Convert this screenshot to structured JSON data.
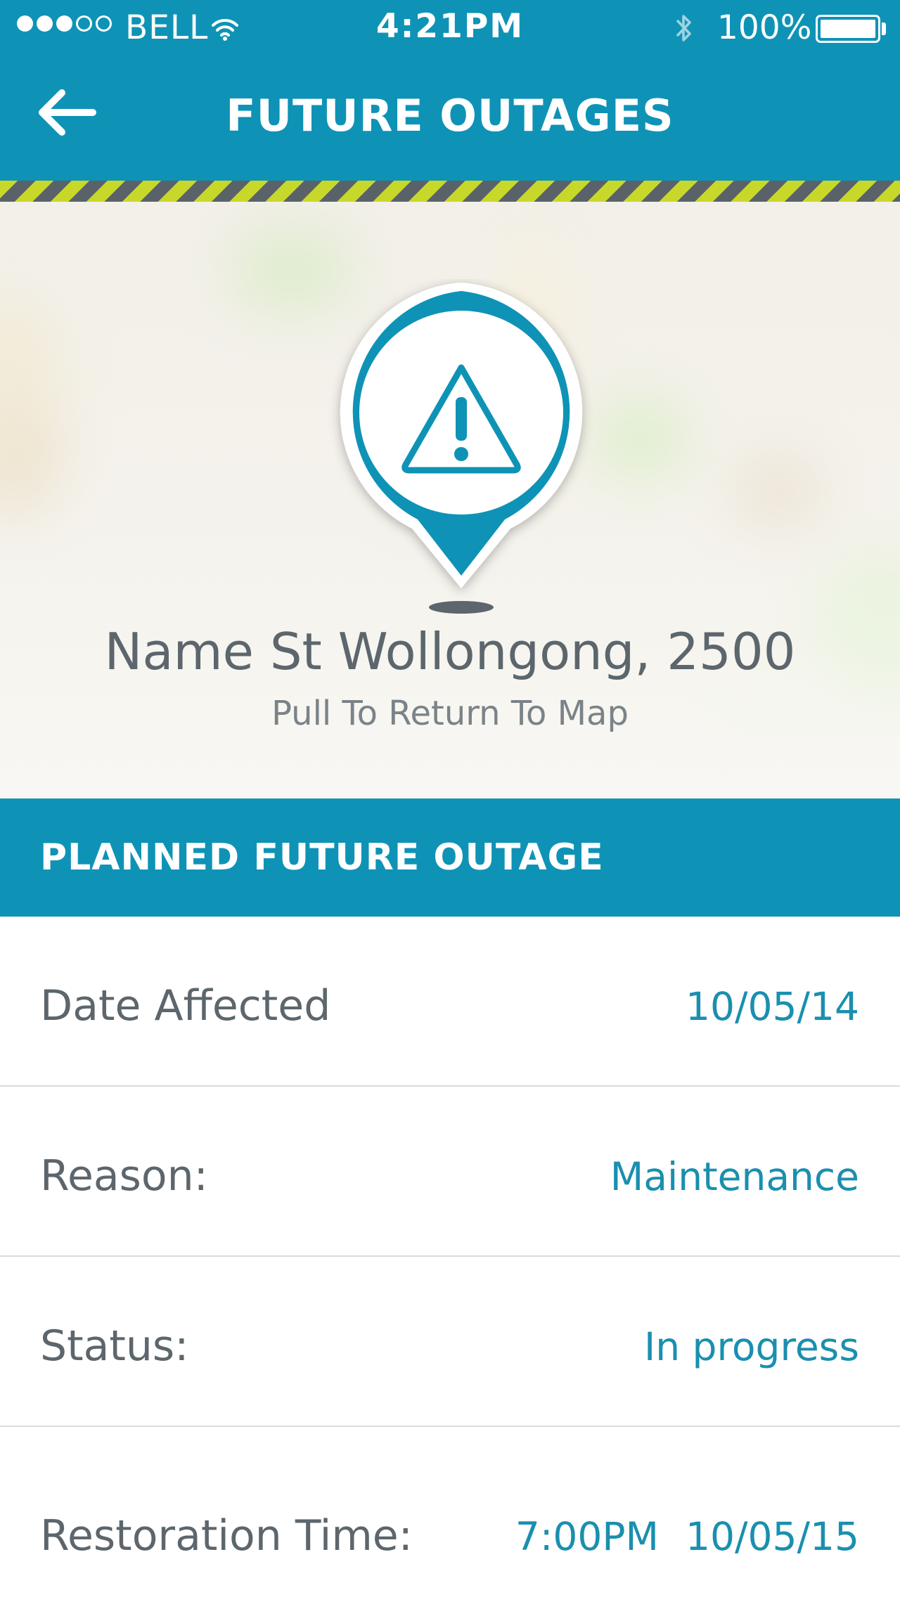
{
  "status_bar": {
    "carrier": "BELL",
    "time": "4:21PM",
    "battery": "100%",
    "battery_level": 1.0
  },
  "header": {
    "title": "FUTURE OUTAGES",
    "back_icon": "arrow-left-icon"
  },
  "hero": {
    "pin_icon": "warning-triangle-icon",
    "location": "Name St Wollongong, 2500",
    "hint": "Pull To Return To Map"
  },
  "section": {
    "title": "PLANNED FUTURE OUTAGE"
  },
  "details": {
    "date_affected": {
      "label": "Date Affected",
      "value": "10/05/14"
    },
    "reason": {
      "label": "Reason:",
      "value": "Maintenance"
    },
    "status": {
      "label": "Status:",
      "value": "In progress"
    },
    "restoration": {
      "label": "Restoration Time:",
      "time": "7:00PM",
      "date": "10/05/15"
    }
  },
  "colors": {
    "brand": "#0e93b6",
    "value_text": "#1a8faf",
    "label_text": "#5c666c",
    "stripe_yellow": "#c8d82a",
    "stripe_gray": "#5a6269"
  }
}
